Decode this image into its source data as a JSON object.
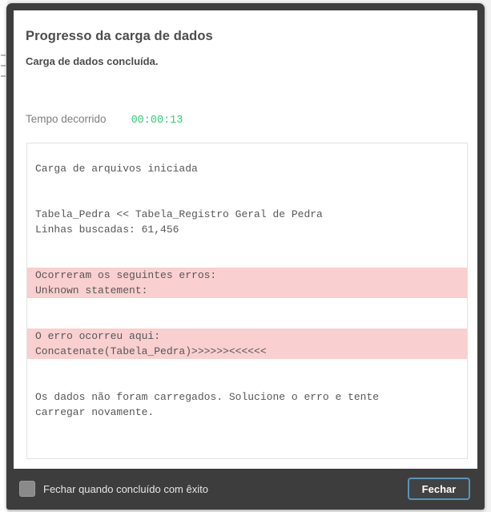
{
  "dialog": {
    "title": "Progresso da carga de dados",
    "status": "Carga de dados concluída.",
    "elapsed_label": "Tempo decorrido",
    "elapsed_value": "00:00:13",
    "elapsed_color": "#34cf76"
  },
  "log": {
    "lines": [
      {
        "text": "Carga de arquivos iniciada",
        "error": false
      },
      {
        "text": "",
        "error": false
      },
      {
        "text": "",
        "error": false
      },
      {
        "text": "Tabela_Pedra << Tabela_Registro Geral de Pedra",
        "error": false
      },
      {
        "text": "Linhas buscadas: 61,456",
        "error": false
      },
      {
        "text": "",
        "error": false
      },
      {
        "text": "",
        "error": false
      },
      {
        "text": "Ocorreram os seguintes erros:",
        "error": true
      },
      {
        "text": "Unknown statement:",
        "error": true
      },
      {
        "text": "",
        "error": false
      },
      {
        "text": "",
        "error": false
      },
      {
        "text": "O erro ocorreu aqui:",
        "error": true
      },
      {
        "text": "Concatenate(Tabela_Pedra)>>>>>><<<<<<",
        "error": true
      },
      {
        "text": "",
        "error": false
      },
      {
        "text": "",
        "error": false
      },
      {
        "text": "Os dados não foram carregados. Solucione o erro e tente",
        "error": false
      },
      {
        "text": "carregar novamente.",
        "error": false
      }
    ],
    "error_highlight_color": "#f9cfcf"
  },
  "footer": {
    "autoclose_label": "Fechar quando concluído com êxito",
    "autoclose_checked": false,
    "close_label": "Fechar",
    "close_border_color": "#5596bb"
  }
}
